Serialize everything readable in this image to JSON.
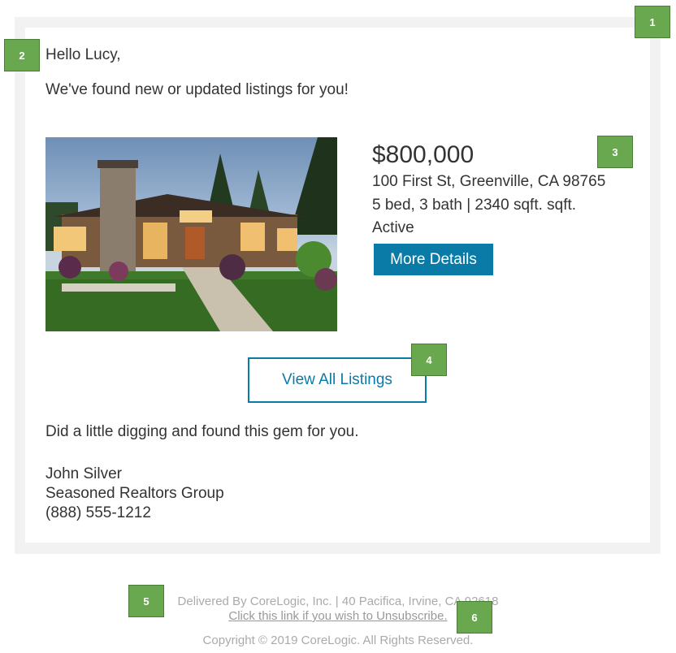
{
  "email": {
    "greeting": "Hello Lucy,",
    "intro": "We've found new or updated listings for you!",
    "listing": {
      "price": "$800,000",
      "address": "100 First St, Greenville, CA 98765",
      "specs": "5 bed, 3 bath | 2340 sqft. sqft.",
      "status": "Active",
      "more_details_label": "More Details",
      "image_icon": "house-photo"
    },
    "view_all_label": "View All Listings",
    "message": "Did a little digging and found this gem for you.",
    "agent": {
      "name": "John Silver",
      "company": "Seasoned Realtors Group",
      "phone": "(888) 555-1212"
    }
  },
  "footer": {
    "delivered": "Delivered By CoreLogic, Inc. | 40 Pacifica, Irvine, CA 92618",
    "unsubscribe": "Click this link if you wish to Unsubscribe.",
    "copyright": "Copyright © 2019 CoreLogic. All Rights Reserved."
  },
  "annotations": {
    "badges": [
      "1",
      "2",
      "3",
      "4",
      "5",
      "6"
    ],
    "badge_color": "#6aa84f"
  },
  "colors": {
    "accent": "#0a7aa6",
    "panel_bg": "#f2f2f2"
  }
}
